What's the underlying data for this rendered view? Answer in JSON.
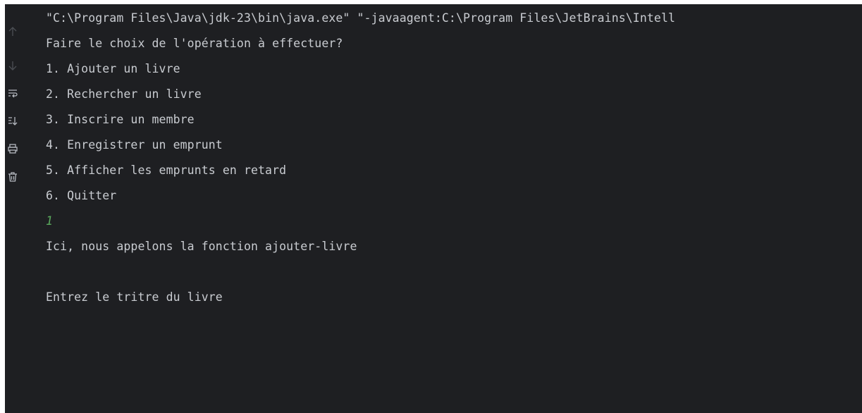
{
  "toolbar": {
    "icons": [
      {
        "name": "scroll-up-icon",
        "enabled": false
      },
      {
        "name": "scroll-down-icon",
        "enabled": false
      },
      {
        "name": "soft-wrap-icon",
        "enabled": true
      },
      {
        "name": "scroll-to-end-icon",
        "enabled": true
      },
      {
        "name": "print-icon",
        "enabled": true
      },
      {
        "name": "clear-all-icon",
        "enabled": true
      }
    ]
  },
  "console": {
    "command_line": "\"C:\\Program Files\\Java\\jdk-23\\bin\\java.exe\" \"-javaagent:C:\\Program Files\\JetBrains\\Intell",
    "prompt": "Faire le choix de l'opération à effectuer?",
    "menu": [
      "1. Ajouter un livre",
      "2. Rechercher un livre",
      "3. Inscrire un membre",
      "4. Enregistrer un emprunt",
      "5. Afficher les emprunts en retard",
      "6. Quitter"
    ],
    "user_input": "1",
    "message": "Ici, nous appelons la fonction ajouter-livre",
    "request": "Entrez le tritre du livre"
  },
  "colors": {
    "background": "#1e1f22",
    "text": "#c9ccd1",
    "user_input": "#5aa95d"
  }
}
